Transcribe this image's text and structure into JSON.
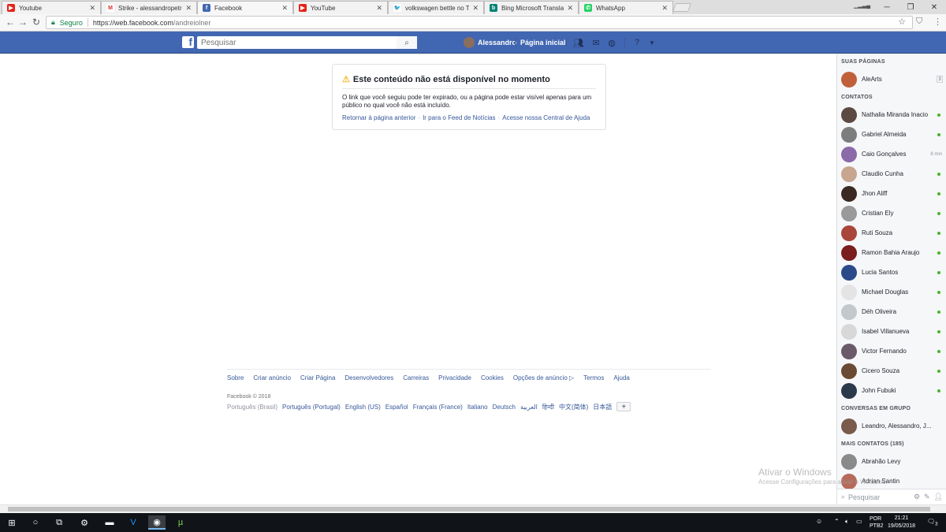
{
  "browser": {
    "tabs": [
      {
        "label": "Youtube",
        "icon": "youtube-icon",
        "icon_color": "#e62117",
        "active": false
      },
      {
        "label": "Strike - alessandropetron",
        "icon": "gmail-icon",
        "icon_color": "#d93025",
        "active": false
      },
      {
        "label": "Facebook",
        "icon": "facebook-icon",
        "icon_color": "#4267b2",
        "active": true
      },
      {
        "label": "YouTube",
        "icon": "youtube-icon",
        "icon_color": "#e62117",
        "active": false
      },
      {
        "label": "volkswagen bettle no Tw",
        "icon": "twitter-icon",
        "icon_color": "#1da1f2",
        "active": false
      },
      {
        "label": "Bing Microsoft Translator",
        "icon": "bing-icon",
        "icon_color": "#008373",
        "active": false
      },
      {
        "label": "WhatsApp",
        "icon": "whatsapp-icon",
        "icon_color": "#25d366",
        "active": false
      }
    ],
    "secure_label": "Seguro",
    "url_host": "https://web.facebook.com",
    "url_path": "/andreiolner"
  },
  "facebook_bar": {
    "search_placeholder": "Pesquisar",
    "user_name": "Alessandro",
    "home_label": "Página inicial",
    "accent": "#4267b2"
  },
  "notice": {
    "title": "Este conteúdo não está disponível no momento",
    "body": "O link que você seguiu pode ter expirado, ou a página pode estar visível apenas para um público no qual você não está incluído.",
    "link_back": "Retornar à página anterior",
    "link_feed": "Ir para o Feed de Notícias",
    "link_help": "Acesse nossa Central de Ajuda"
  },
  "footer": {
    "links": [
      "Sobre",
      "Criar anúncio",
      "Criar Página",
      "Desenvolvedores",
      "Carreiras",
      "Privacidade",
      "Cookies",
      "Opções de anúncio",
      "Termos",
      "Ajuda"
    ],
    "copyright": "Facebook © 2018",
    "current_language": "Português (Brasil)",
    "languages": [
      "Português (Portugal)",
      "English (US)",
      "Español",
      "Français (France)",
      "Italiano",
      "Deutsch",
      "العربية",
      "हिन्दी",
      "中文(简体)",
      "日本語"
    ]
  },
  "sidebar": {
    "pages_header": "SUAS PÁGINAS",
    "pages": [
      {
        "name": "AleArts",
        "badge": "3"
      }
    ],
    "contacts_header": "CONTATOS",
    "contacts": [
      {
        "name": "Nathalia Miranda Inacio",
        "status": "online",
        "avatar_color": "#5a4a42"
      },
      {
        "name": "Gabriel Almeida",
        "status": "online",
        "avatar_color": "#7d7d7d"
      },
      {
        "name": "Caio Gonçalves",
        "status": "8 min",
        "avatar_color": "#8a6aa8"
      },
      {
        "name": "Claudio Cunha",
        "status": "online",
        "avatar_color": "#c7a58e"
      },
      {
        "name": "Jhon Aliff",
        "status": "online",
        "avatar_color": "#3a2a22"
      },
      {
        "name": "Cristian Ely",
        "status": "online",
        "avatar_color": "#9a9a9a"
      },
      {
        "name": "Ruti Souza",
        "status": "online",
        "avatar_color": "#a8463c"
      },
      {
        "name": "Ramon Bahia Araujo",
        "status": "online",
        "avatar_color": "#7a1e1e"
      },
      {
        "name": "Lucia Santos",
        "status": "online",
        "avatar_color": "#2a4a8a"
      },
      {
        "name": "Michael Douglas",
        "status": "online",
        "avatar_color": "#e4e4e4"
      },
      {
        "name": "Déh Oliveira",
        "status": "online",
        "avatar_color": "#c2c8cc"
      },
      {
        "name": "Isabel Villanueva",
        "status": "online",
        "avatar_color": "#d8d8d8"
      },
      {
        "name": "Victor Fernando",
        "status": "online",
        "avatar_color": "#6a5a6a"
      },
      {
        "name": "Cicero Souza",
        "status": "online",
        "avatar_color": "#6a4a32"
      },
      {
        "name": "John Fubuki",
        "status": "online",
        "avatar_color": "#2a3a4a"
      }
    ],
    "groups_header": "CONVERSAS EM GRUPO",
    "groups": [
      {
        "name": "Leandro, Alessandro, J..."
      }
    ],
    "more_header": "MAIS CONTATOS (185)",
    "more": [
      {
        "name": "Abrahão Levy",
        "avatar_color": "#8a8a8a"
      },
      {
        "name": "Adrian Santin",
        "avatar_color": "#b56a5a"
      }
    ],
    "search_placeholder": "Pesquisar"
  },
  "watermark": {
    "line1": "Ativar o Windows",
    "line2": "Acesse Configurações para ativar o Windows."
  },
  "taskbar": {
    "language": "POR",
    "layout": "PTB2",
    "time": "21:21",
    "date": "19/05/2018",
    "notifications": "3"
  }
}
